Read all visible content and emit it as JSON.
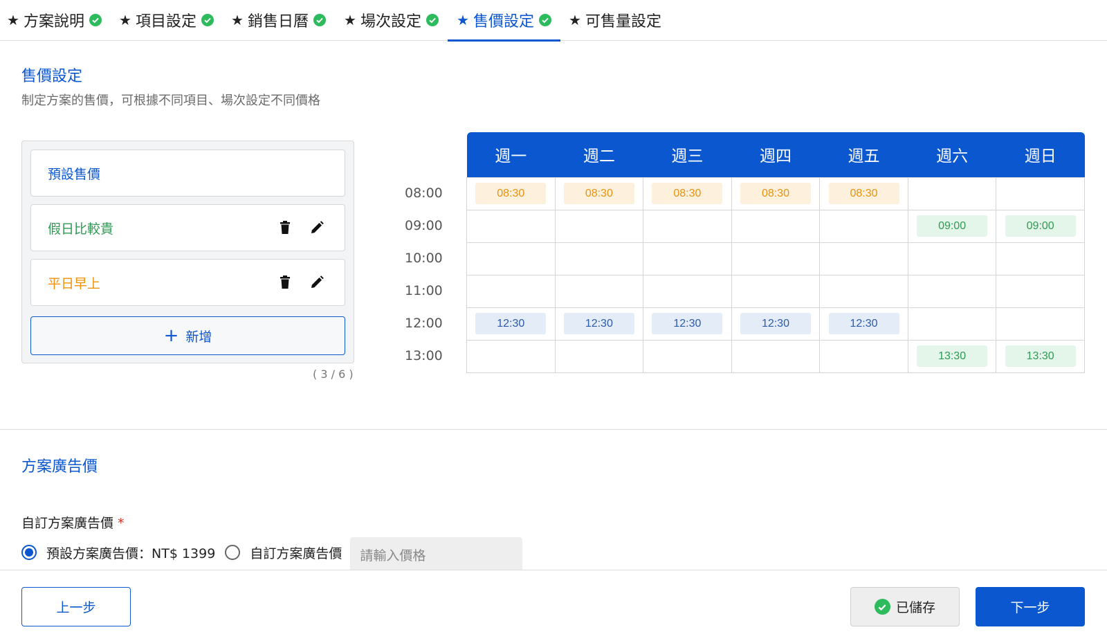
{
  "tabs": [
    {
      "label": "方案說明",
      "done": true,
      "active": false
    },
    {
      "label": "項目設定",
      "done": true,
      "active": false
    },
    {
      "label": "銷售日曆",
      "done": true,
      "active": false
    },
    {
      "label": "場次設定",
      "done": true,
      "active": false
    },
    {
      "label": "售價設定",
      "done": true,
      "active": true
    },
    {
      "label": "可售量設定",
      "done": false,
      "active": false
    }
  ],
  "price_section": {
    "title": "售價設定",
    "description": "制定方案的售價，可根據不同項目、場次設定不同價格"
  },
  "price_list": {
    "items": [
      {
        "label": "預設售價",
        "color": "#0b57d0",
        "editable": false
      },
      {
        "label": "假日比較貴",
        "color": "#2f9a53",
        "editable": true
      },
      {
        "label": "平日早上",
        "color": "#f0900a",
        "editable": true
      }
    ],
    "add_label": "新增",
    "counter": "( 3 / 6 )"
  },
  "schedule": {
    "days": [
      "週一",
      "週二",
      "週三",
      "週四",
      "週五",
      "週六",
      "週日"
    ],
    "times": [
      "08:00",
      "09:00",
      "10:00",
      "11:00",
      "12:00",
      "13:00"
    ],
    "rows": [
      [
        {
          "t": "08:30",
          "c": "orange"
        },
        {
          "t": "08:30",
          "c": "orange"
        },
        {
          "t": "08:30",
          "c": "orange"
        },
        {
          "t": "08:30",
          "c": "orange"
        },
        {
          "t": "08:30",
          "c": "orange"
        },
        null,
        null
      ],
      [
        null,
        null,
        null,
        null,
        null,
        {
          "t": "09:00",
          "c": "green"
        },
        {
          "t": "09:00",
          "c": "green"
        }
      ],
      [
        null,
        null,
        null,
        null,
        null,
        null,
        null
      ],
      [
        null,
        null,
        null,
        null,
        null,
        null,
        null
      ],
      [
        {
          "t": "12:30",
          "c": "blue"
        },
        {
          "t": "12:30",
          "c": "blue"
        },
        {
          "t": "12:30",
          "c": "blue"
        },
        {
          "t": "12:30",
          "c": "blue"
        },
        {
          "t": "12:30",
          "c": "blue"
        },
        null,
        null
      ],
      [
        null,
        null,
        null,
        null,
        null,
        {
          "t": "13:30",
          "c": "green"
        },
        {
          "t": "13:30",
          "c": "green"
        }
      ]
    ]
  },
  "ad_section": {
    "title": "方案廣告價",
    "field_label": "自訂方案廣告價",
    "required_mark": "*",
    "option_default": "預設方案廣告價：NT$ 1399",
    "option_custom": "自訂方案廣告價",
    "input_placeholder": "請輸入價格",
    "input_value": "",
    "selected": "default"
  },
  "footer": {
    "prev_label": "上一步",
    "saved_label": "已儲存",
    "next_label": "下一步"
  },
  "colors": {
    "primary": "#0b57d0",
    "success": "#2dbb5d",
    "orange_slot": "#e8920f",
    "green_slot": "#2f9a53",
    "blue_slot": "#2b5aa8"
  },
  "icons": [
    "star-icon",
    "check-circle-icon",
    "trash-icon",
    "pencil-icon",
    "plus-icon"
  ]
}
